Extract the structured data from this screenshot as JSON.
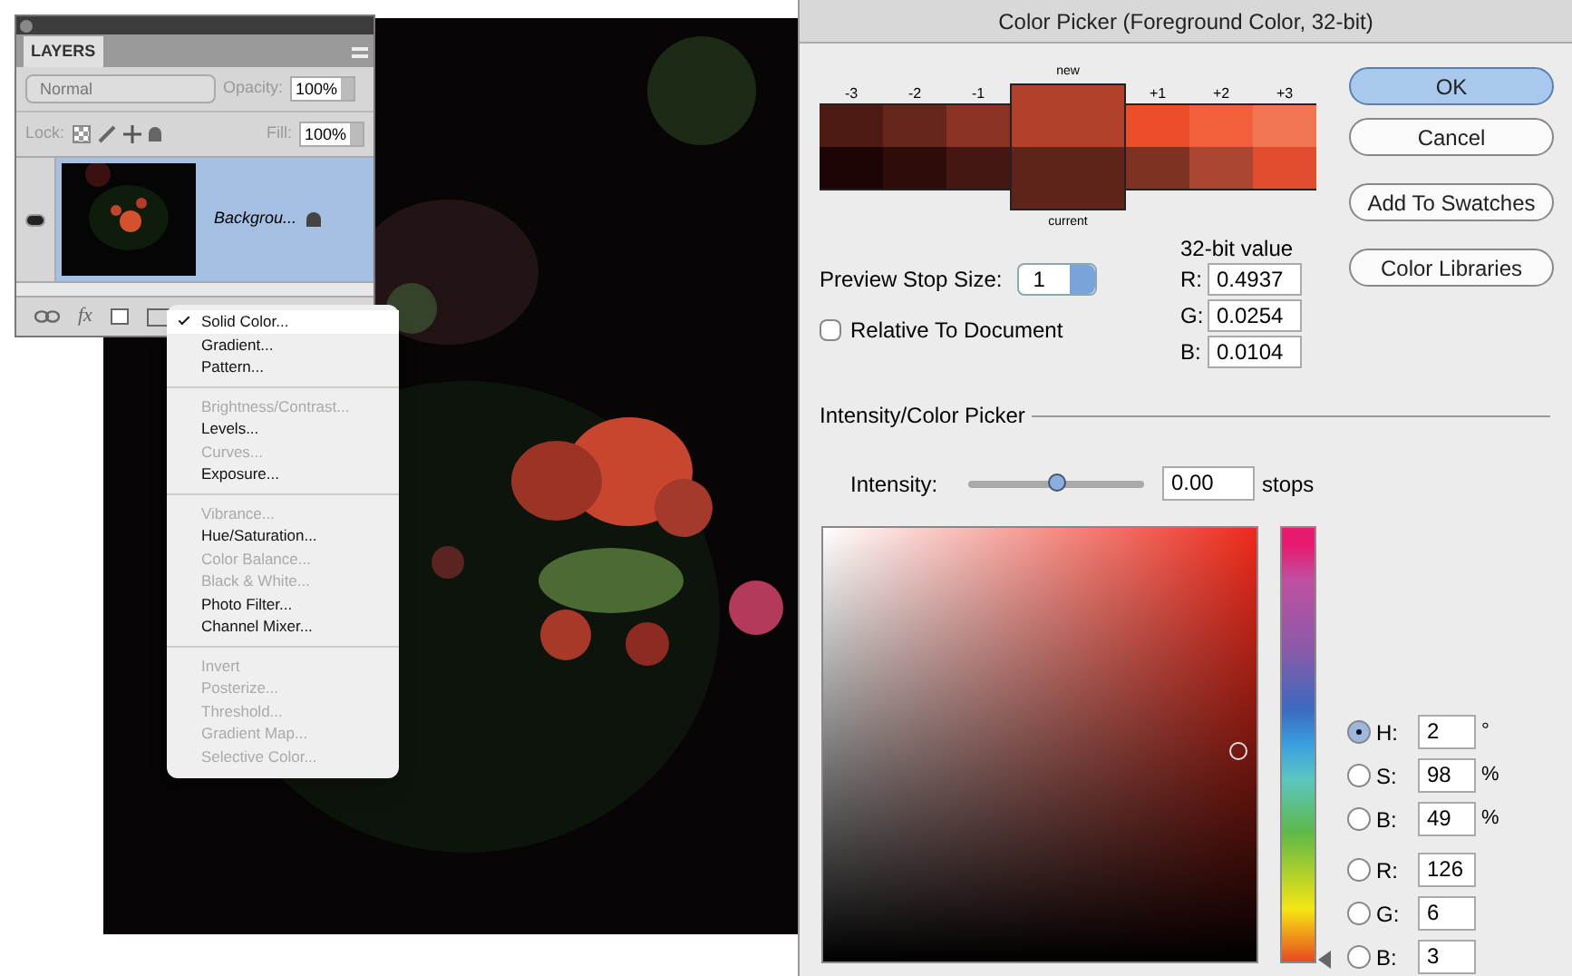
{
  "layers_panel": {
    "tab": "LAYERS",
    "blend_mode": "Normal",
    "opacity_label": "Opacity:",
    "opacity": "100%",
    "lock_label": "Lock:",
    "fx_button": "fx",
    "fill_label": "Fill:",
    "fill": "100%",
    "layers": [
      {
        "name": "Backgrou...",
        "visible": true,
        "selected": true,
        "locked": true
      }
    ]
  },
  "adjustment_menu": {
    "groups": [
      [
        {
          "label": "Solid Color...",
          "checked": true,
          "disabled": false
        },
        {
          "label": "Gradient...",
          "checked": false,
          "disabled": false
        },
        {
          "label": "Pattern...",
          "checked": false,
          "disabled": false
        }
      ],
      [
        {
          "label": "Brightness/Contrast...",
          "checked": false,
          "disabled": true
        },
        {
          "label": "Levels...",
          "checked": false,
          "disabled": false
        },
        {
          "label": "Curves...",
          "checked": false,
          "disabled": true
        },
        {
          "label": "Exposure...",
          "checked": false,
          "disabled": false
        }
      ],
      [
        {
          "label": "Vibrance...",
          "checked": false,
          "disabled": true
        },
        {
          "label": "Hue/Saturation...",
          "checked": false,
          "disabled": false
        },
        {
          "label": "Color Balance...",
          "checked": false,
          "disabled": true
        },
        {
          "label": "Black & White...",
          "checked": false,
          "disabled": true
        },
        {
          "label": "Photo Filter...",
          "checked": false,
          "disabled": false
        },
        {
          "label": "Channel Mixer...",
          "checked": false,
          "disabled": false
        }
      ],
      [
        {
          "label": "Invert",
          "checked": false,
          "disabled": true
        },
        {
          "label": "Posterize...",
          "checked": false,
          "disabled": true
        },
        {
          "label": "Threshold...",
          "checked": false,
          "disabled": true
        },
        {
          "label": "Gradient Map...",
          "checked": false,
          "disabled": true
        },
        {
          "label": "Selective Color...",
          "checked": false,
          "disabled": true
        }
      ]
    ]
  },
  "color_picker": {
    "title": "Color Picker (Foreground Color, 32-bit)",
    "new_label": "new",
    "current_label": "current",
    "stops": [
      {
        "label": "-3",
        "color": "#4e1a14"
      },
      {
        "label": "-2",
        "color": "#66261a"
      },
      {
        "label": "-1",
        "color": "#8a3324"
      },
      {
        "color": "#b1402a"
      },
      {
        "label": "+1",
        "color": "#ec4d2b"
      },
      {
        "label": "+2",
        "color": "#f1603d"
      },
      {
        "label": "+3",
        "color": "#f07651"
      }
    ],
    "current_stops": [
      {
        "color": "#1e0505"
      },
      {
        "color": "#2e0c0a"
      },
      {
        "color": "#451612"
      },
      {
        "color": "#5e241a"
      },
      {
        "color": "#7d3222"
      },
      {
        "color": "#ab4630"
      },
      {
        "color": "#e24c2f"
      }
    ],
    "buttons": [
      {
        "label": "OK",
        "kind": "default"
      },
      {
        "label": "Cancel",
        "kind": "normal"
      },
      {
        "label": "Add To Swatches",
        "kind": "normal"
      },
      {
        "label": "Color Libraries",
        "kind": "normal"
      }
    ],
    "preview_stop_size": {
      "label": "Preview Stop Size:",
      "value": "1"
    },
    "relative_to_document": {
      "label": "Relative To Document",
      "checked": false
    },
    "value_32bit": {
      "heading": "32-bit value",
      "fields": [
        {
          "label": "R:",
          "value": "0.4937"
        },
        {
          "label": "G:",
          "value": "0.0254"
        },
        {
          "label": "B:",
          "value": "0.0104"
        }
      ]
    },
    "section_title": "Intensity/Color Picker",
    "intensity": {
      "label": "Intensity:",
      "level": 0.5,
      "value": "0.00",
      "unit": "stops"
    },
    "hue_slider": {
      "level": 0.01
    },
    "channels": [
      {
        "label": "H:",
        "value": "2",
        "unit": "°",
        "selected": true
      },
      {
        "label": "S:",
        "value": "98",
        "unit": "%",
        "selected": false
      },
      {
        "label": "B:",
        "value": "49",
        "unit": "%",
        "selected": false
      },
      {
        "label": "R:",
        "value": "126",
        "selected": false
      },
      {
        "label": "G:",
        "value": "6",
        "selected": false
      },
      {
        "label": "B:",
        "value": "3",
        "selected": false
      }
    ]
  }
}
